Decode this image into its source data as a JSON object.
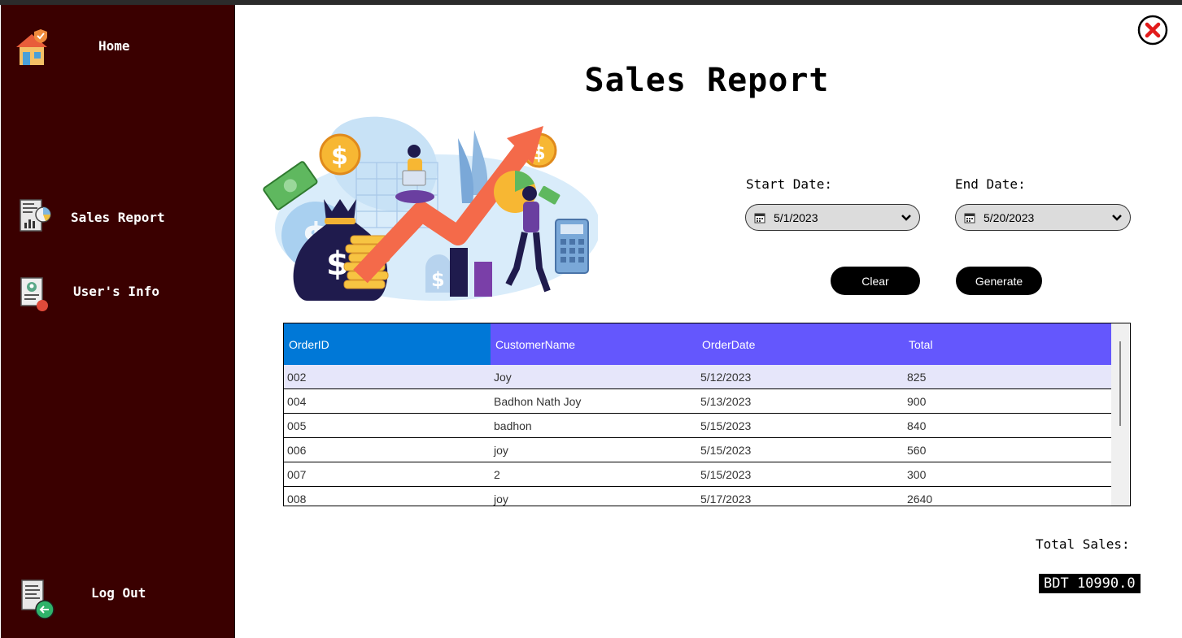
{
  "sidebar": {
    "home_label": "Home",
    "sales_report_label": "Sales Report",
    "users_info_label": "User's Info",
    "logout_label": "Log Out"
  },
  "header": {
    "title": "Sales Report"
  },
  "filters": {
    "start_label": "Start Date:",
    "start_value": "5/1/2023",
    "end_label": "End Date:",
    "end_value": "5/20/2023",
    "clear_label": "Clear",
    "generate_label": "Generate"
  },
  "table": {
    "columns": [
      "OrderID",
      "CustomerName",
      "OrderDate",
      "Total"
    ],
    "rows": [
      [
        "002",
        "Joy",
        "5/12/2023",
        "825"
      ],
      [
        "004",
        "Badhon Nath Joy",
        "5/13/2023",
        "900"
      ],
      [
        "005",
        "badhon",
        "5/15/2023",
        "840"
      ],
      [
        "006",
        "joy",
        "5/15/2023",
        "560"
      ],
      [
        "007",
        "2",
        "5/15/2023",
        "300"
      ],
      [
        "008",
        "joy",
        "5/17/2023",
        "2640"
      ]
    ]
  },
  "totals": {
    "label": "Total Sales:",
    "value": "BDT 10990.0"
  },
  "colors": {
    "sidebar_bg": "#3a0000",
    "grid_header": "#6457fd",
    "grid_header_selected": "#0078d7",
    "row_selected": "#e6e6fa"
  },
  "icons": [
    "home-icon",
    "sales-report-icon",
    "user-info-icon",
    "logout-icon",
    "close-icon",
    "calendar-icon",
    "chevron-down-icon"
  ]
}
